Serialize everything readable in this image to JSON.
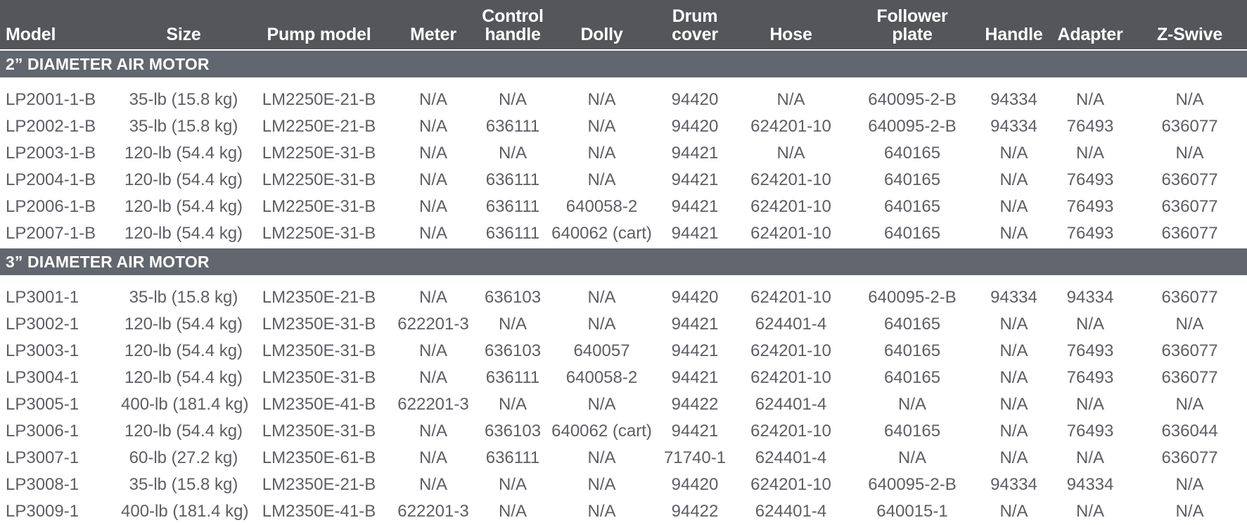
{
  "table": {
    "columns": [
      {
        "id": "model",
        "label": "Model",
        "label_line1": "",
        "label_line2": "Model",
        "align": "left"
      },
      {
        "id": "size",
        "label": "Size",
        "label_line1": "",
        "label_line2": "Size",
        "align": "center"
      },
      {
        "id": "pump_model",
        "label": "Pump model",
        "label_line1": "",
        "label_line2": "Pump model",
        "align": "center"
      },
      {
        "id": "meter",
        "label": "Meter",
        "label_line1": "",
        "label_line2": "Meter",
        "align": "center"
      },
      {
        "id": "control_handle",
        "label": "Control handle",
        "label_line1": "Control",
        "label_line2": "handle",
        "align": "center"
      },
      {
        "id": "dolly",
        "label": "Dolly",
        "label_line1": "",
        "label_line2": "Dolly",
        "align": "center"
      },
      {
        "id": "drum_cover",
        "label": "Drum cover",
        "label_line1": "Drum",
        "label_line2": "cover",
        "align": "center"
      },
      {
        "id": "hose",
        "label": "Hose",
        "label_line1": "",
        "label_line2": "Hose",
        "align": "center"
      },
      {
        "id": "follower_plate",
        "label": "Follower plate",
        "label_line1": "Follower",
        "label_line2": "plate",
        "align": "center"
      },
      {
        "id": "handle",
        "label": "Handle",
        "label_line1": "",
        "label_line2": "Handle",
        "align": "center"
      },
      {
        "id": "adapter",
        "label": "Adapter",
        "label_line1": "",
        "label_line2": "Adapter",
        "align": "center"
      },
      {
        "id": "z_swivel",
        "label": "Z-Swive",
        "label_line1": "",
        "label_line2": "Z-Swive",
        "align": "center"
      }
    ],
    "sections": [
      {
        "title": "2” DIAMETER AIR MOTOR",
        "rows": [
          {
            "model": "LP2001-1-B",
            "size": "35-lb (15.8 kg)",
            "pump_model": "LM2250E-21-B",
            "meter": "N/A",
            "control_handle": "N/A",
            "dolly": "N/A",
            "drum_cover": "94420",
            "hose": "N/A",
            "follower_plate": "640095-2-B",
            "handle": "94334",
            "adapter": "N/A",
            "z_swivel": "N/A"
          },
          {
            "model": "LP2002-1-B",
            "size": "35-lb (15.8 kg)",
            "pump_model": "LM2250E-21-B",
            "meter": "N/A",
            "control_handle": "636111",
            "dolly": "N/A",
            "drum_cover": "94420",
            "hose": "624201-10",
            "follower_plate": "640095-2-B",
            "handle": "94334",
            "adapter": "76493",
            "z_swivel": "636077"
          },
          {
            "model": "LP2003-1-B",
            "size": "120-lb (54.4 kg)",
            "pump_model": "LM2250E-31-B",
            "meter": "N/A",
            "control_handle": "N/A",
            "dolly": "N/A",
            "drum_cover": "94421",
            "hose": "N/A",
            "follower_plate": "640165",
            "handle": "N/A",
            "adapter": "N/A",
            "z_swivel": "N/A"
          },
          {
            "model": "LP2004-1-B",
            "size": "120-lb (54.4 kg)",
            "pump_model": "LM2250E-31-B",
            "meter": "N/A",
            "control_handle": "636111",
            "dolly": "N/A",
            "drum_cover": "94421",
            "hose": "624201-10",
            "follower_plate": "640165",
            "handle": "N/A",
            "adapter": "76493",
            "z_swivel": "636077"
          },
          {
            "model": "LP2006-1-B",
            "size": "120-lb (54.4 kg)",
            "pump_model": "LM2250E-31-B",
            "meter": "N/A",
            "control_handle": "636111",
            "dolly": "640058-2",
            "drum_cover": "94421",
            "hose": "624201-10",
            "follower_plate": "640165",
            "handle": "N/A",
            "adapter": "76493",
            "z_swivel": "636077"
          },
          {
            "model": "LP2007-1-B",
            "size": "120-lb (54.4 kg)",
            "pump_model": "LM2250E-31-B",
            "meter": "N/A",
            "control_handle": "636111",
            "dolly": "640062 (cart)",
            "drum_cover": "94421",
            "hose": "624201-10",
            "follower_plate": "640165",
            "handle": "N/A",
            "adapter": "76493",
            "z_swivel": "636077"
          }
        ]
      },
      {
        "title": "3” DIAMETER AIR MOTOR",
        "rows": [
          {
            "model": "LP3001-1",
            "size": "35-lb (15.8 kg)",
            "pump_model": "LM2350E-21-B",
            "meter": "N/A",
            "control_handle": "636103",
            "dolly": "N/A",
            "drum_cover": "94420",
            "hose": "624201-10",
            "follower_plate": "640095-2-B",
            "handle": "94334",
            "adapter": "94334",
            "z_swivel": "636077"
          },
          {
            "model": "LP3002-1",
            "size": "120-lb (54.4 kg)",
            "pump_model": "LM2350E-31-B",
            "meter": "622201-3",
            "control_handle": "N/A",
            "dolly": "N/A",
            "drum_cover": "94421",
            "hose": "624401-4",
            "follower_plate": "640165",
            "handle": "N/A",
            "adapter": "N/A",
            "z_swivel": "N/A"
          },
          {
            "model": "LP3003-1",
            "size": "120-lb (54.4 kg)",
            "pump_model": "LM2350E-31-B",
            "meter": "N/A",
            "control_handle": "636103",
            "dolly": "640057",
            "drum_cover": "94421",
            "hose": "624201-10",
            "follower_plate": "640165",
            "handle": "N/A",
            "adapter": "76493",
            "z_swivel": "636077"
          },
          {
            "model": "LP3004-1",
            "size": "120-lb (54.4 kg)",
            "pump_model": "LM2350E-31-B",
            "meter": "N/A",
            "control_handle": "636111",
            "dolly": "640058-2",
            "drum_cover": "94421",
            "hose": "624201-10",
            "follower_plate": "640165",
            "handle": "N/A",
            "adapter": "76493",
            "z_swivel": "636077"
          },
          {
            "model": "LP3005-1",
            "size": "400-lb (181.4 kg)",
            "pump_model": "LM2350E-41-B",
            "meter": "622201-3",
            "control_handle": "N/A",
            "dolly": "N/A",
            "drum_cover": "94422",
            "hose": "624401-4",
            "follower_plate": "N/A",
            "handle": "N/A",
            "adapter": "N/A",
            "z_swivel": "N/A"
          },
          {
            "model": "LP3006-1",
            "size": "120-lb (54.4 kg)",
            "pump_model": "LM2350E-31-B",
            "meter": "N/A",
            "control_handle": "636103",
            "dolly": "640062 (cart)",
            "drum_cover": "94421",
            "hose": "624201-10",
            "follower_plate": "640165",
            "handle": "N/A",
            "adapter": "76493",
            "z_swivel": "636044"
          },
          {
            "model": "LP3007-1",
            "size": "60-lb (27.2 kg)",
            "pump_model": "LM2350E-61-B",
            "meter": "N/A",
            "control_handle": "636111",
            "dolly": "N/A",
            "drum_cover": "71740-1",
            "hose": "624401-4",
            "follower_plate": "N/A",
            "handle": "N/A",
            "adapter": "N/A",
            "z_swivel": "636077"
          },
          {
            "model": "LP3008-1",
            "size": "35-lb (15.8 kg)",
            "pump_model": "LM2350E-21-B",
            "meter": "N/A",
            "control_handle": "N/A",
            "dolly": "N/A",
            "drum_cover": "94420",
            "hose": "624201-10",
            "follower_plate": "640095-2-B",
            "handle": "94334",
            "adapter": "94334",
            "z_swivel": "N/A"
          },
          {
            "model": "LP3009-1",
            "size": "400-lb (181.4 kg)",
            "pump_model": "LM2350E-41-B",
            "meter": "622201-3",
            "control_handle": "N/A",
            "dolly": "N/A",
            "drum_cover": "94422",
            "hose": "624401-4",
            "follower_plate": "640015-1",
            "handle": "N/A",
            "adapter": "N/A",
            "z_swivel": "N/A"
          }
        ]
      }
    ]
  },
  "colors": {
    "header_bar": "#55565a",
    "section_bar": "#62666e",
    "header_text": "#ffffff",
    "body_text": "#5d5e64",
    "page_background": "#ffffff"
  }
}
